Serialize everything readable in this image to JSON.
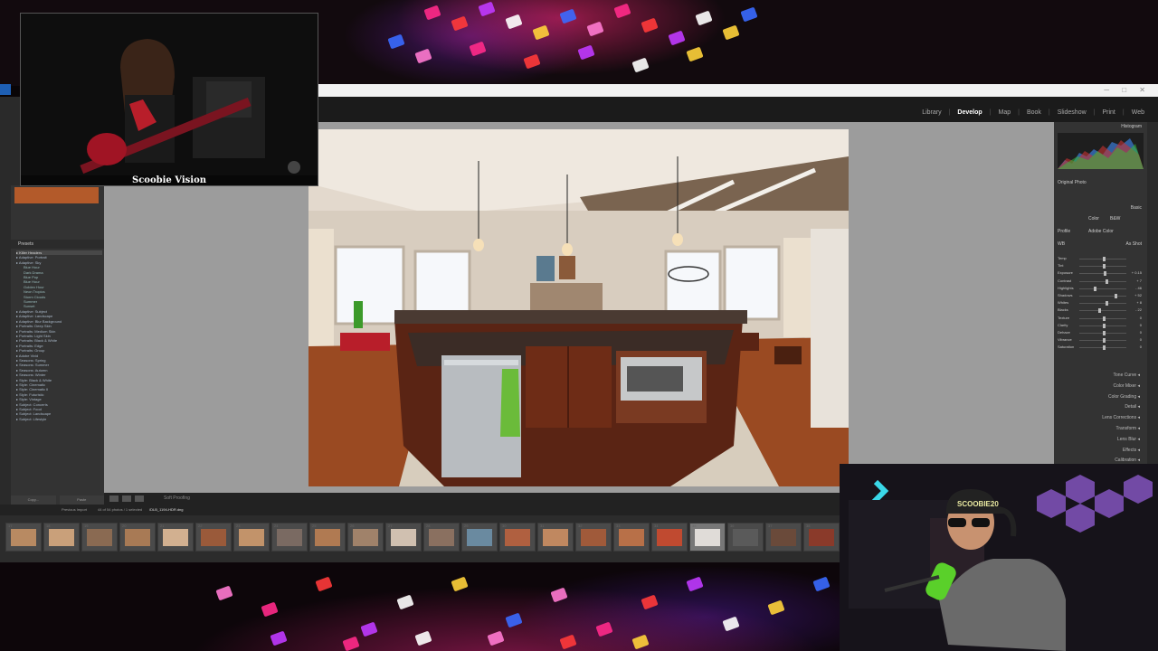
{
  "app": {
    "name": "Adobe Lightroom Classic",
    "modules": [
      "Library",
      "Develop",
      "Map",
      "Book",
      "Slideshow",
      "Print",
      "Web"
    ],
    "active_module": "Develop"
  },
  "stream": {
    "overlay_title": "Scoobie Vision",
    "cap_text": "SCOOBIE20"
  },
  "left_panel": {
    "presets_header": "Presets",
    "presets": [
      {
        "label": "Killer Headers",
        "level": 0,
        "highlight": true
      },
      {
        "label": "Adaptive: Portrait",
        "level": 0
      },
      {
        "label": "Adaptive: Sky",
        "level": 0
      },
      {
        "label": "Blue Hour",
        "level": 1
      },
      {
        "label": "Dark Drama",
        "level": 1
      },
      {
        "label": "Blue Pop",
        "level": 1
      },
      {
        "label": "Blue Hour",
        "level": 1
      },
      {
        "label": "Golden Hour",
        "level": 1
      },
      {
        "label": "Neon Tropics",
        "level": 1
      },
      {
        "label": "Storm Clouds",
        "level": 1
      },
      {
        "label": "Summer",
        "level": 1
      },
      {
        "label": "Sunset",
        "level": 1
      },
      {
        "label": "Adaptive: Subject",
        "level": 0
      },
      {
        "label": "Adaptive: Landscape",
        "level": 0
      },
      {
        "label": "Adaptive: Blur Background",
        "level": 0
      },
      {
        "label": "Portraits: Deep Skin",
        "level": 0
      },
      {
        "label": "Portraits: Medium Skin",
        "level": 0
      },
      {
        "label": "Portraits: Light Skin",
        "level": 0
      },
      {
        "label": "Portraits: Black & White",
        "level": 0
      },
      {
        "label": "Portraits: Edge",
        "level": 0
      },
      {
        "label": "Portraits: Group",
        "level": 0
      },
      {
        "label": "Adobe Vivid",
        "level": 0
      },
      {
        "label": "Seasons: Spring",
        "level": 0
      },
      {
        "label": "Seasons: Summer",
        "level": 0
      },
      {
        "label": "Seasons: Autumn",
        "level": 0
      },
      {
        "label": "Seasons: Winter",
        "level": 0
      },
      {
        "label": "Style: Black & White",
        "level": 0
      },
      {
        "label": "Style: Cinematic",
        "level": 0
      },
      {
        "label": "Style: Cinematic II",
        "level": 0
      },
      {
        "label": "Style: Futuristic",
        "level": 0
      },
      {
        "label": "Style: Vintage",
        "level": 0
      },
      {
        "label": "Subject: Concerts",
        "level": 0
      },
      {
        "label": "Subject: Food",
        "level": 0
      },
      {
        "label": "Subject: Landscape",
        "level": 0
      },
      {
        "label": "Subject: Lifestyle",
        "level": 0
      }
    ],
    "copy_label": "Copy...",
    "paste_label": "Paste"
  },
  "toolbar": {
    "soft_proofing": "Soft Proofing"
  },
  "filmbar": {
    "previous_import": "Previous Import",
    "photo_count": "44 of 54 photos / 1 selected",
    "filename": "/DLB_1194-HDR.dng"
  },
  "right_panel": {
    "histogram_label": "Histogram",
    "original_photo": "Original Photo",
    "basic_label": "Basic",
    "treatment": [
      "Color",
      "B&W"
    ],
    "profile_label": "Profile",
    "profile_value": "Adobe Color",
    "wb_label": "WB",
    "wb_value": "As Shot",
    "sliders": [
      {
        "label": "Temp",
        "value": "",
        "pos": 0.5
      },
      {
        "label": "Tint",
        "value": "",
        "pos": 0.5
      },
      {
        "label": "Exposure",
        "value": "+ 0.15",
        "pos": 0.52
      },
      {
        "label": "Contrast",
        "value": "+ 7",
        "pos": 0.55
      },
      {
        "label": "Highlights",
        "value": "- 46",
        "pos": 0.3
      },
      {
        "label": "Shadows",
        "value": "+ 52",
        "pos": 0.75
      },
      {
        "label": "Whites",
        "value": "+ 8",
        "pos": 0.55
      },
      {
        "label": "Blacks",
        "value": "- 22",
        "pos": 0.4
      },
      {
        "label": "Texture",
        "value": "0",
        "pos": 0.5
      },
      {
        "label": "Clarity",
        "value": "0",
        "pos": 0.5
      },
      {
        "label": "Dehaze",
        "value": "0",
        "pos": 0.5
      },
      {
        "label": "Vibrance",
        "value": "0",
        "pos": 0.5
      },
      {
        "label": "Saturation",
        "value": "0",
        "pos": 0.5
      }
    ],
    "sections": [
      "Tone Curve",
      "Color Mixer",
      "Color Grading",
      "Detail",
      "Lens Corrections",
      "Transform",
      "Lens Blur",
      "Effects",
      "Calibration"
    ]
  },
  "filmstrip": {
    "numbers": [
      "17",
      "18",
      "19",
      "20",
      "21",
      "22",
      "23",
      "24",
      "25",
      "26",
      "27",
      "28",
      "29",
      "30",
      "31",
      "32",
      "33",
      "34",
      "35",
      "36",
      "37",
      "38"
    ],
    "selected_index": 18
  }
}
